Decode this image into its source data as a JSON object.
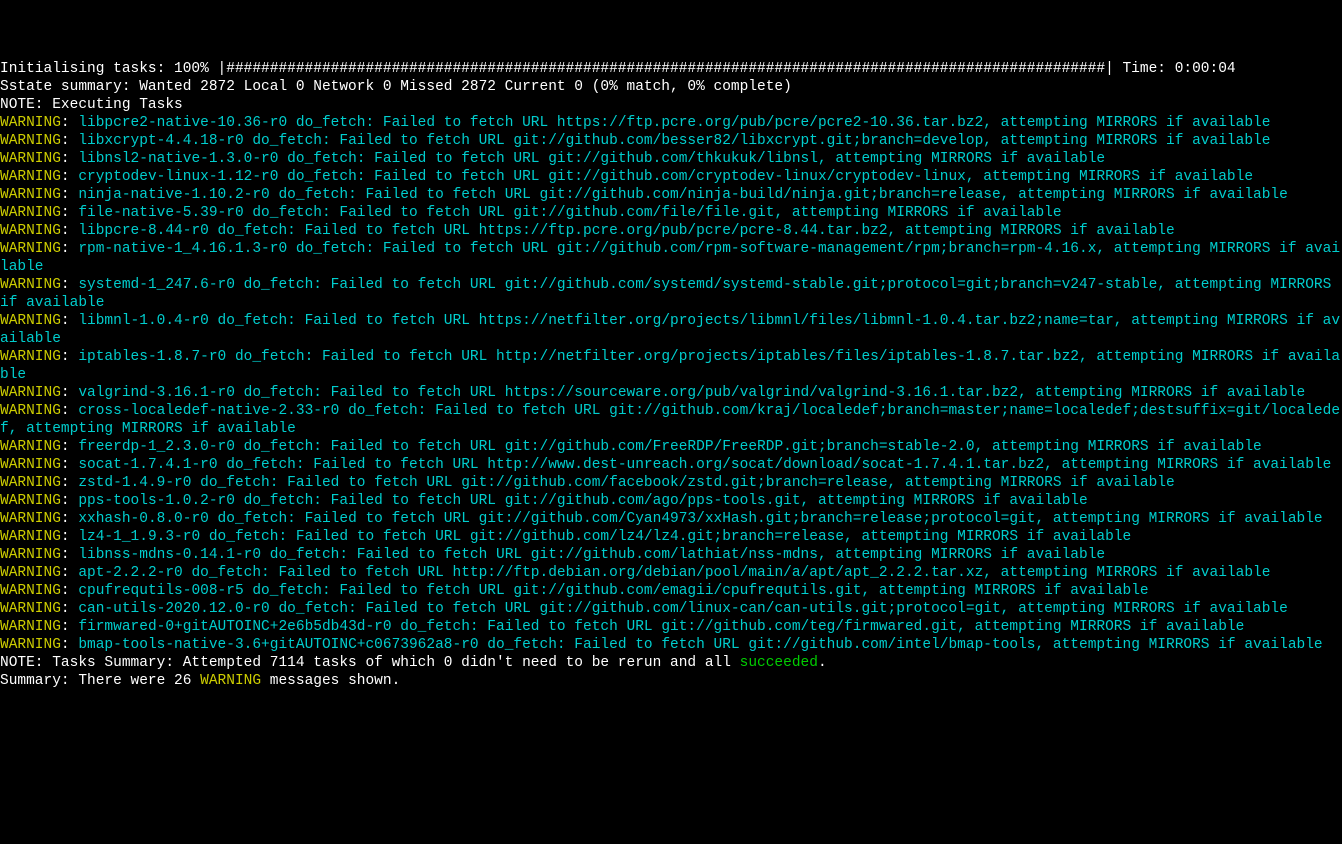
{
  "init_line": "Initialising tasks: 100% |#####################################################################################################| Time: 0:00:04",
  "sstate_line": "Sstate summary: Wanted 2872 Local 0 Network 0 Missed 2872 Current 0 (0% match, 0% complete)",
  "note_exec": "NOTE: Executing Tasks",
  "warn_label": "WARNING",
  "colon_space": ": ",
  "warnings": [
    "libpcre2-native-10.36-r0 do_fetch: Failed to fetch URL https://ftp.pcre.org/pub/pcre/pcre2-10.36.tar.bz2, attempting MIRRORS if available",
    "libxcrypt-4.4.18-r0 do_fetch: Failed to fetch URL git://github.com/besser82/libxcrypt.git;branch=develop, attempting MIRRORS if available",
    "libnsl2-native-1.3.0-r0 do_fetch: Failed to fetch URL git://github.com/thkukuk/libnsl, attempting MIRRORS if available",
    "cryptodev-linux-1.12-r0 do_fetch: Failed to fetch URL git://github.com/cryptodev-linux/cryptodev-linux, attempting MIRRORS if available",
    "ninja-native-1.10.2-r0 do_fetch: Failed to fetch URL git://github.com/ninja-build/ninja.git;branch=release, attempting MIRRORS if available",
    "file-native-5.39-r0 do_fetch: Failed to fetch URL git://github.com/file/file.git, attempting MIRRORS if available",
    "libpcre-8.44-r0 do_fetch: Failed to fetch URL https://ftp.pcre.org/pub/pcre/pcre-8.44.tar.bz2, attempting MIRRORS if available",
    "rpm-native-1_4.16.1.3-r0 do_fetch: Failed to fetch URL git://github.com/rpm-software-management/rpm;branch=rpm-4.16.x, attempting MIRRORS if available",
    "systemd-1_247.6-r0 do_fetch: Failed to fetch URL git://github.com/systemd/systemd-stable.git;protocol=git;branch=v247-stable, attempting MIRRORS if available",
    "libmnl-1.0.4-r0 do_fetch: Failed to fetch URL https://netfilter.org/projects/libmnl/files/libmnl-1.0.4.tar.bz2;name=tar, attempting MIRRORS if available",
    "iptables-1.8.7-r0 do_fetch: Failed to fetch URL http://netfilter.org/projects/iptables/files/iptables-1.8.7.tar.bz2, attempting MIRRORS if available",
    "valgrind-3.16.1-r0 do_fetch: Failed to fetch URL https://sourceware.org/pub/valgrind/valgrind-3.16.1.tar.bz2, attempting MIRRORS if available",
    "cross-localedef-native-2.33-r0 do_fetch: Failed to fetch URL git://github.com/kraj/localedef;branch=master;name=localedef;destsuffix=git/localedef, attempting MIRRORS if available",
    "freerdp-1_2.3.0-r0 do_fetch: Failed to fetch URL git://github.com/FreeRDP/FreeRDP.git;branch=stable-2.0, attempting MIRRORS if available",
    "socat-1.7.4.1-r0 do_fetch: Failed to fetch URL http://www.dest-unreach.org/socat/download/socat-1.7.4.1.tar.bz2, attempting MIRRORS if available",
    "zstd-1.4.9-r0 do_fetch: Failed to fetch URL git://github.com/facebook/zstd.git;branch=release, attempting MIRRORS if available",
    "pps-tools-1.0.2-r0 do_fetch: Failed to fetch URL git://github.com/ago/pps-tools.git, attempting MIRRORS if available",
    "xxhash-0.8.0-r0 do_fetch: Failed to fetch URL git://github.com/Cyan4973/xxHash.git;branch=release;protocol=git, attempting MIRRORS if available",
    "lz4-1_1.9.3-r0 do_fetch: Failed to fetch URL git://github.com/lz4/lz4.git;branch=release, attempting MIRRORS if available",
    "libnss-mdns-0.14.1-r0 do_fetch: Failed to fetch URL git://github.com/lathiat/nss-mdns, attempting MIRRORS if available",
    "apt-2.2.2-r0 do_fetch: Failed to fetch URL http://ftp.debian.org/debian/pool/main/a/apt/apt_2.2.2.tar.xz, attempting MIRRORS if available",
    "cpufrequtils-008-r5 do_fetch: Failed to fetch URL git://github.com/emagii/cpufrequtils.git, attempting MIRRORS if available",
    "can-utils-2020.12.0-r0 do_fetch: Failed to fetch URL git://github.com/linux-can/can-utils.git;protocol=git, attempting MIRRORS if available",
    "firmwared-0+gitAUTOINC+2e6b5db43d-r0 do_fetch: Failed to fetch URL git://github.com/teg/firmwared.git, attempting MIRRORS if available",
    "bmap-tools-native-3.6+gitAUTOINC+c0673962a8-r0 do_fetch: Failed to fetch URL git://github.com/intel/bmap-tools, attempting MIRRORS if available"
  ],
  "tasks_summary_pre": "NOTE: Tasks Summary: Attempted 7114 tasks of which 0 didn't need to be rerun and all ",
  "tasks_summary_succ": "succeeded",
  "tasks_summary_post": ".",
  "blank": "",
  "summary_pre": "Summary: There were 26 ",
  "summary_warn": "WARNING",
  "summary_post": " messages shown."
}
